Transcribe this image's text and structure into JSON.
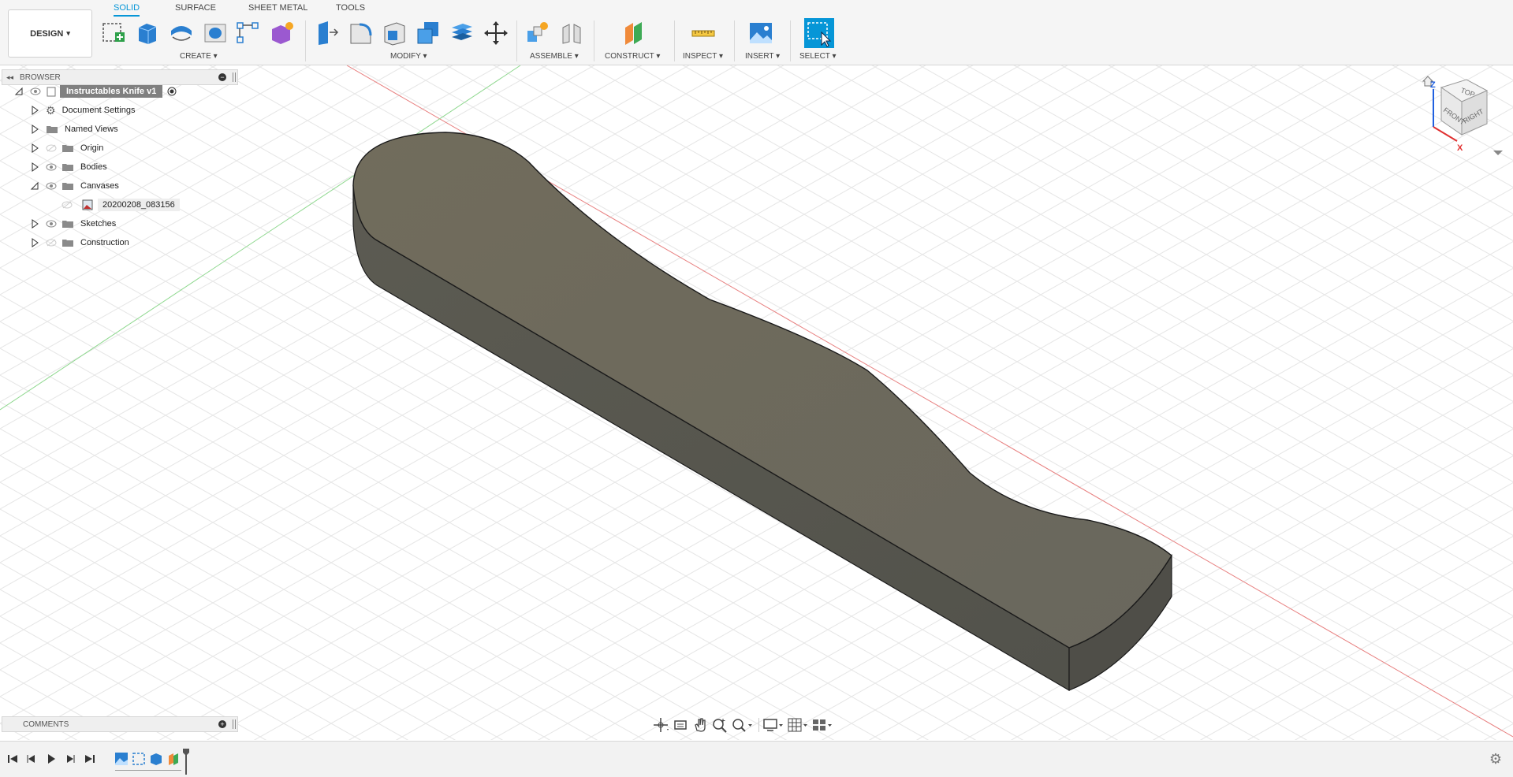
{
  "toolbar": {
    "workspace_label": "DESIGN",
    "tabs": [
      {
        "label": "SOLID",
        "active": true
      },
      {
        "label": "SURFACE",
        "active": false
      },
      {
        "label": "SHEET METAL",
        "active": false
      },
      {
        "label": "TOOLS",
        "active": false
      }
    ],
    "groups": {
      "create": "CREATE",
      "modify": "MODIFY",
      "assemble": "ASSEMBLE",
      "construct": "CONSTRUCT",
      "inspect": "INSPECT",
      "insert": "INSERT",
      "select": "SELECT"
    },
    "dropdown_glyph": "▾",
    "accent_color": "#0696d7"
  },
  "browser": {
    "title": "BROWSER",
    "root": "Instructables Knife v1",
    "items": [
      {
        "label": "Document Settings",
        "icon": "gear-icon"
      },
      {
        "label": "Named Views",
        "icon": "folder-icon"
      },
      {
        "label": "Origin",
        "icon": "folder-icon"
      },
      {
        "label": "Bodies",
        "icon": "folder-icon"
      },
      {
        "label": "Canvases",
        "icon": "folder-icon"
      },
      {
        "label": "20200208_083156",
        "icon": "canvas-image-icon"
      },
      {
        "label": "Sketches",
        "icon": "folder-icon"
      },
      {
        "label": "Construction",
        "icon": "folder-icon"
      }
    ]
  },
  "comments": {
    "title": "COMMENTS"
  },
  "viewcube": {
    "faces": {
      "top": "TOP",
      "front": "FRONT",
      "right": "RIGHT"
    },
    "axes": {
      "z": "Z",
      "x": "X"
    }
  },
  "colors": {
    "body_top": "#6e6a5e",
    "body_side": "#5a5950",
    "x_axis": "#e05050",
    "y_axis": "#60c060",
    "grid": "#e4e4e4"
  }
}
